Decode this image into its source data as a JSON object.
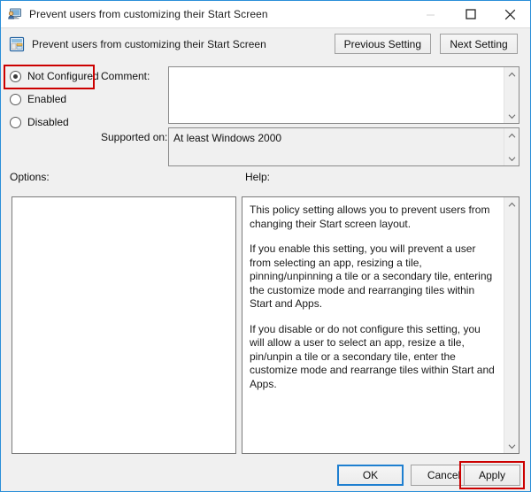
{
  "window": {
    "title": "Prevent users from customizing their Start Screen",
    "title_icon": "policy-monitor-icon",
    "minimize_label": "minimize-icon",
    "maximize_label": "maximize-icon",
    "close_label": "close-icon",
    "accent_color": "#2a8fd8",
    "highlight_color": "#cc0000"
  },
  "header": {
    "policy_icon": "group-policy-setting-icon",
    "policy_title": "Prevent users from customizing their Start Screen",
    "previous_setting": "Previous Setting",
    "next_setting": "Next Setting"
  },
  "state": {
    "selected": "Not Configured",
    "options": [
      {
        "label": "Not Configured",
        "checked": true,
        "highlighted": true
      },
      {
        "label": "Enabled",
        "checked": false,
        "highlighted": false
      },
      {
        "label": "Disabled",
        "checked": false,
        "highlighted": false
      }
    ]
  },
  "comment": {
    "label": "Comment:",
    "value": "",
    "scroll_up_icon": "chevron-up-icon",
    "scroll_down_icon": "chevron-down-icon"
  },
  "supported_on": {
    "label": "Supported on:",
    "value": "At least Windows 2000",
    "scroll_up_icon": "chevron-up-icon",
    "scroll_down_icon": "chevron-down-icon"
  },
  "options_panel": {
    "label": "Options:",
    "content": ""
  },
  "help_panel": {
    "label": "Help:",
    "paragraphs": [
      "This policy setting allows you to prevent users from changing their Start screen layout.",
      "If you enable this setting, you will prevent a user from selecting an app, resizing a tile, pinning/unpinning a tile or a secondary tile, entering the customize mode and rearranging tiles within Start and Apps.",
      "If you disable or do not configure this setting, you will allow a user to select an app, resize a tile, pin/unpin a tile or a secondary tile, enter the customize mode and rearrange tiles within Start and Apps."
    ],
    "scroll_up_icon": "chevron-up-icon",
    "scroll_down_icon": "chevron-down-icon"
  },
  "footer": {
    "ok": "OK",
    "cancel": "Cancel",
    "apply": "Apply",
    "default_button": "OK",
    "highlighted_button": "Apply"
  }
}
